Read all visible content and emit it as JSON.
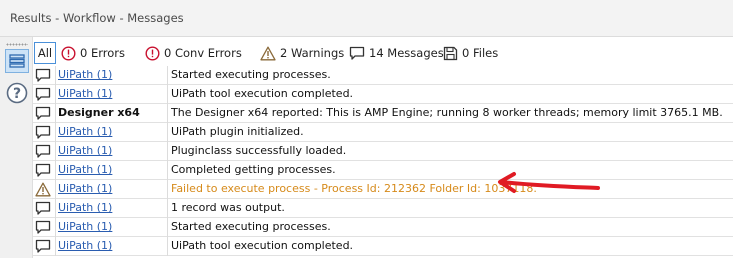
{
  "window": {
    "title": "Results - Workflow - Messages"
  },
  "rail": {
    "list_icon": "list-icon",
    "help_icon": "help-icon"
  },
  "filters": {
    "all": "All",
    "errors": "0 Errors",
    "conv_errors": "0 Conv Errors",
    "warnings": "2 Warnings",
    "messages": "14 Messages",
    "files": "0 Files"
  },
  "rows": [
    {
      "icon": "message-icon",
      "tool": "UiPath (1)",
      "message": "Started executing processes.",
      "kind": "message"
    },
    {
      "icon": "message-icon",
      "tool": "UiPath (1)",
      "message": "UiPath tool execution completed.",
      "kind": "message"
    },
    {
      "icon": "message-icon",
      "tool": "Designer x64",
      "message": "The Designer x64 reported: This is AMP Engine; running 8 worker threads; memory limit 3765.1 MB.",
      "kind": "designer"
    },
    {
      "icon": "message-icon",
      "tool": "UiPath (1)",
      "message": "UiPath plugin initialized.",
      "kind": "message"
    },
    {
      "icon": "message-icon",
      "tool": "UiPath (1)",
      "message": "Pluginclass successfully loaded.",
      "kind": "message"
    },
    {
      "icon": "message-icon",
      "tool": "UiPath (1)",
      "message": "Completed getting processes.",
      "kind": "message"
    },
    {
      "icon": "warning-icon",
      "tool": "UiPath (1)",
      "message": "Failed to execute process - Process Id: 212362 Folder Id: 1037118.",
      "kind": "warning"
    },
    {
      "icon": "message-icon",
      "tool": "UiPath (1)",
      "message": "1 record was output.",
      "kind": "message"
    },
    {
      "icon": "message-icon",
      "tool": "UiPath (1)",
      "message": "Started executing processes.",
      "kind": "message"
    },
    {
      "icon": "message-icon",
      "tool": "UiPath (1)",
      "message": "UiPath tool execution completed.",
      "kind": "message"
    }
  ],
  "colors": {
    "warning_text": "#d68a1a",
    "link": "#2a5db0",
    "annotation_arrow": "#e01b24"
  }
}
